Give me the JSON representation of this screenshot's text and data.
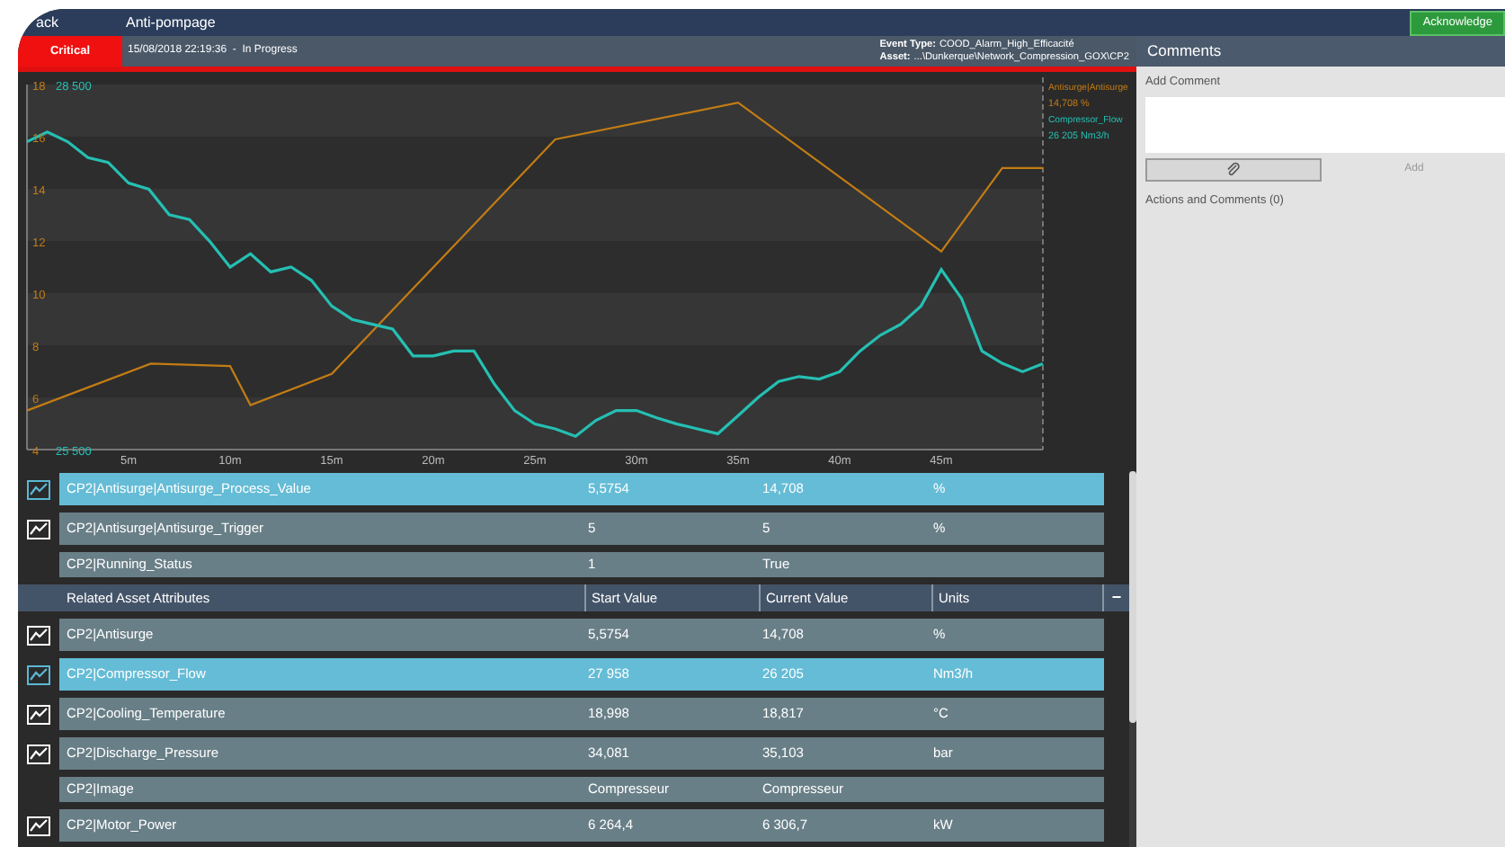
{
  "header": {
    "back": "ack",
    "title": "Anti-pompage",
    "acknowledge": "Acknowledge"
  },
  "alarm": {
    "severity": "Critical",
    "time_status": "15/08/2018 22:19:36  -  In Progress",
    "event_type_label": "Event Type:",
    "event_type": "COOD_Alarm_High_Efficacité",
    "asset_label": "Asset:",
    "asset": "...\\Dunkerque\\Network_Compression_GOX\\CP2"
  },
  "chart": {
    "legend": [
      "14,708 %",
      "26 205 Nm3/h"
    ],
    "chart_data": {
      "type": "line",
      "xlim": [
        0,
        50
      ],
      "ylim": [
        4,
        18
      ],
      "y2lim": [
        25500,
        28500
      ],
      "xticks": [
        {
          "value": 5,
          "label": "5m"
        },
        {
          "value": 10,
          "label": "10m"
        },
        {
          "value": 15,
          "label": "15m"
        },
        {
          "value": 20,
          "label": "20m"
        },
        {
          "value": 25,
          "label": "25m"
        },
        {
          "value": 30,
          "label": "30m"
        },
        {
          "value": 35,
          "label": "35m"
        },
        {
          "value": 40,
          "label": "40m"
        },
        {
          "value": 45,
          "label": "45m"
        }
      ],
      "yticks": [
        {
          "value": 4,
          "label": "4"
        },
        {
          "value": 6,
          "label": "6"
        },
        {
          "value": 8,
          "label": "8"
        },
        {
          "value": 10,
          "label": "10"
        },
        {
          "value": 12,
          "label": "12"
        },
        {
          "value": 14,
          "label": "14"
        },
        {
          "value": 16,
          "label": "16"
        },
        {
          "value": 18,
          "label": "18"
        }
      ],
      "y2ticks": [
        {
          "value": 28500,
          "label": "28 500"
        },
        {
          "value": 25500,
          "label": "25 500"
        }
      ],
      "series": [
        {
          "name": "Antisurge|Antisurge",
          "color": "#c27c14",
          "x": [
            0,
            6.1,
            10,
            11,
            15,
            26,
            35,
            45,
            48,
            50
          ],
          "values": [
            5.5,
            7.3,
            7.2,
            5.7,
            6.9,
            15.9,
            17.3,
            11.6,
            14.8,
            14.8
          ]
        },
        {
          "name": "Compressor_Flow",
          "color": "#25bfb3",
          "axis": "y2",
          "x": [
            0,
            1,
            2,
            3,
            4,
            5,
            6,
            7,
            8,
            9,
            10,
            11,
            12,
            13,
            14,
            15,
            16,
            17,
            18,
            19,
            20,
            21,
            22,
            23,
            24,
            25,
            26,
            27,
            28,
            29,
            30,
            31,
            32,
            33,
            34,
            35,
            36,
            37,
            38,
            39,
            40,
            41,
            42,
            43,
            44,
            45,
            46,
            47,
            48,
            49,
            50
          ],
          "values": [
            28030,
            28110,
            28030,
            27900,
            27860,
            27690,
            27640,
            27430,
            27390,
            27210,
            27000,
            27110,
            26960,
            27000,
            26890,
            26680,
            26570,
            26530,
            26490,
            26270,
            26270,
            26310,
            26310,
            26040,
            25820,
            25710,
            25670,
            25610,
            25740,
            25820,
            25820,
            25760,
            25710,
            25670,
            25630,
            25780,
            25930,
            26060,
            26100,
            26080,
            26140,
            26310,
            26440,
            26530,
            26680,
            26980,
            26740,
            26310,
            26210,
            26140,
            26205
          ]
        }
      ]
    }
  },
  "top_rows": [
    {
      "name": "CP2|Antisurge|Antisurge_Process_Value",
      "start": "5,5754",
      "current": "14,708",
      "units": "%",
      "trend": true,
      "selected": true
    },
    {
      "name": "CP2|Antisurge|Antisurge_Trigger",
      "start": "5",
      "current": "5",
      "units": "%",
      "trend": true,
      "selected": false
    },
    {
      "name": "CP2|Running_Status",
      "start": "1",
      "current": "True",
      "trend": false,
      "selected": false
    }
  ],
  "table": {
    "columns": [
      "Related Asset Attributes",
      "Start Value",
      "Current Value",
      "Units"
    ],
    "collapse": "−",
    "rows": [
      {
        "name": "CP2|Antisurge",
        "start": "5,5754",
        "current": "14,708",
        "units": "%",
        "trend": true,
        "selected": false
      },
      {
        "name": "CP2|Compressor_Flow",
        "start": "27 958",
        "current": "26 205",
        "units": "Nm3/h",
        "trend": true,
        "selected": true
      },
      {
        "name": "CP2|Cooling_Temperature",
        "start": "18,998",
        "current": "18,817",
        "units": "°C",
        "trend": true,
        "selected": false
      },
      {
        "name": "CP2|Discharge_Pressure",
        "start": "34,081",
        "current": "35,103",
        "units": "bar",
        "trend": true,
        "selected": false
      },
      {
        "name": "CP2|Image",
        "start": "Compresseur",
        "current": "Compresseur",
        "trend": false,
        "selected": false
      },
      {
        "name": "CP2|Motor_Power",
        "start": "6 264,4",
        "current": "6 306,7",
        "units": "kW",
        "trend": true,
        "selected": false
      }
    ]
  },
  "comments": {
    "title": "Comments",
    "add_label": "Add Comment",
    "add_button": "Add",
    "add_disabled": true,
    "actions": "Actions and Comments (0)"
  }
}
